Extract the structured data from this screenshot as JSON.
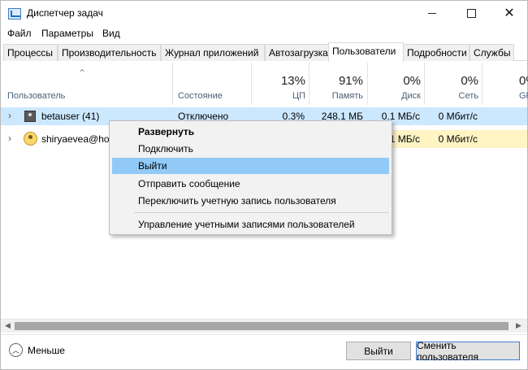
{
  "window": {
    "title": "Диспетчер задач",
    "icon": "task-manager-icon",
    "controls": [
      "minimize-icon",
      "maximize-icon",
      "close-icon"
    ]
  },
  "menu": [
    "Файл",
    "Параметры",
    "Вид"
  ],
  "tabs": [
    {
      "label": "Процессы",
      "active": false
    },
    {
      "label": "Производительность",
      "active": false
    },
    {
      "label": "Журнал приложений",
      "active": false
    },
    {
      "label": "Автозагрузка",
      "active": false
    },
    {
      "label": "Пользователи",
      "active": true
    },
    {
      "label": "Подробности",
      "active": false
    },
    {
      "label": "Службы",
      "active": false
    }
  ],
  "columns": {
    "user": "Пользователь",
    "status": "Состояние",
    "cpu": {
      "pct": "13%",
      "label": "ЦП"
    },
    "memory": {
      "pct": "91%",
      "label": "Память"
    },
    "disk": {
      "pct": "0%",
      "label": "Диск"
    },
    "network": {
      "pct": "0%",
      "label": "Сеть"
    },
    "gpu": {
      "pct": "0%",
      "label": "GPU"
    }
  },
  "rows": [
    {
      "name": "betauser (41)",
      "status": "Отключено",
      "cpu": "0.3%",
      "memory": "248.1 МБ",
      "disk": "0.1 МБ/с",
      "network": "0 Мбит/с"
    },
    {
      "name": "shiryaevea@hot",
      "status": "",
      "cpu": "",
      "memory": "",
      "disk": "1 МБ/с",
      "network": "0 Мбит/с"
    }
  ],
  "context_menu": {
    "items": [
      {
        "label": "Развернуть",
        "bold": true,
        "highlighted": false
      },
      {
        "label": "Подключить",
        "bold": false,
        "highlighted": false
      },
      {
        "label": "Выйти",
        "bold": false,
        "highlighted": true
      },
      {
        "label": "Отправить сообщение",
        "bold": false,
        "highlighted": false
      },
      {
        "label": "Переключить учетную запись пользователя",
        "bold": false,
        "highlighted": false
      }
    ],
    "after_separator": "Управление учетными записями пользователей"
  },
  "footer": {
    "fewer_label": "Меньше",
    "logout_button": "Выйти",
    "switch_button": "Сменить пользователя"
  },
  "colors": {
    "selected_row": "#cce8ff",
    "menu_highlight": "#91c9f7",
    "metric_yellow": "#fff4c4"
  }
}
